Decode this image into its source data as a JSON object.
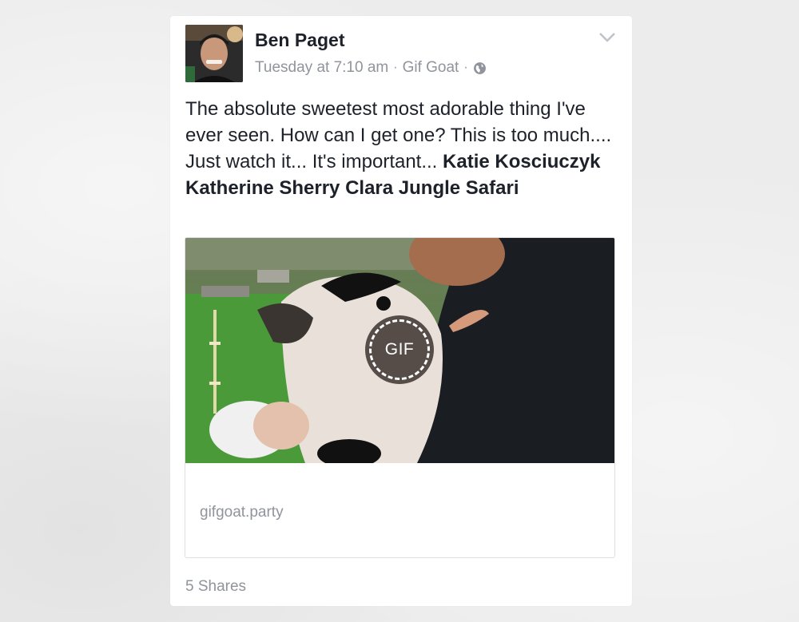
{
  "post": {
    "author": "Ben Paget",
    "timestamp": "Tuesday at 7:10 am",
    "via": "Gif Goat",
    "separator": "·",
    "text_main": "The absolute sweetest most adorable thing I've ever seen. How can I get one? This is too much.... Just watch it... It's important... ",
    "tags": "Katie Kosciuczyk Katherine Sherry Clara Jungle Safari",
    "privacy_icon": "globe-icon",
    "menu_icon": "chevron-down-icon"
  },
  "attachment": {
    "badge_label": "GIF",
    "domain": "gifgoat.party"
  },
  "footer": {
    "shares": "5 Shares"
  },
  "colors": {
    "background": "#ececec",
    "card": "#ffffff",
    "text_primary": "#1d2129",
    "text_secondary": "#90949c"
  }
}
